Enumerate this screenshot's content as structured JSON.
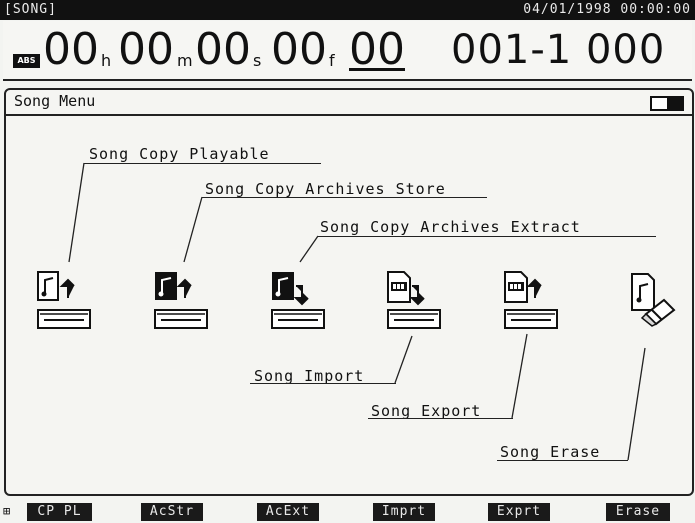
{
  "status_bar": {
    "screen_name": "[SONG]",
    "datetime": "04/01/1998 00:00:00"
  },
  "time_display": {
    "mode_badge": "ABS",
    "hours": "00",
    "hours_unit": "h",
    "minutes": "00",
    "minutes_unit": "m",
    "seconds": "00",
    "seconds_unit": "s",
    "frames": "00",
    "frames_unit": "f",
    "subframes": "00",
    "measure_beat_tick": "001-1 000"
  },
  "window": {
    "title": "Song Menu",
    "menu_items": [
      {
        "label": "Song Copy Playable",
        "icon": "song-copy-playable-icon"
      },
      {
        "label": "Song Copy Archives Store",
        "icon": "song-copy-archives-store-icon"
      },
      {
        "label": "Song Copy Archives Extract",
        "icon": "song-copy-archives-extract-icon"
      },
      {
        "label": "Song Import",
        "icon": "song-import-icon"
      },
      {
        "label": "Song Export",
        "icon": "song-export-icon"
      },
      {
        "label": "Song Erase",
        "icon": "song-erase-icon"
      }
    ]
  },
  "function_buttons": [
    {
      "label": "CP PL"
    },
    {
      "label": "AcStr"
    },
    {
      "label": "AcExt"
    },
    {
      "label": "Imprt"
    },
    {
      "label": "Exprt"
    },
    {
      "label": "Erase"
    }
  ]
}
